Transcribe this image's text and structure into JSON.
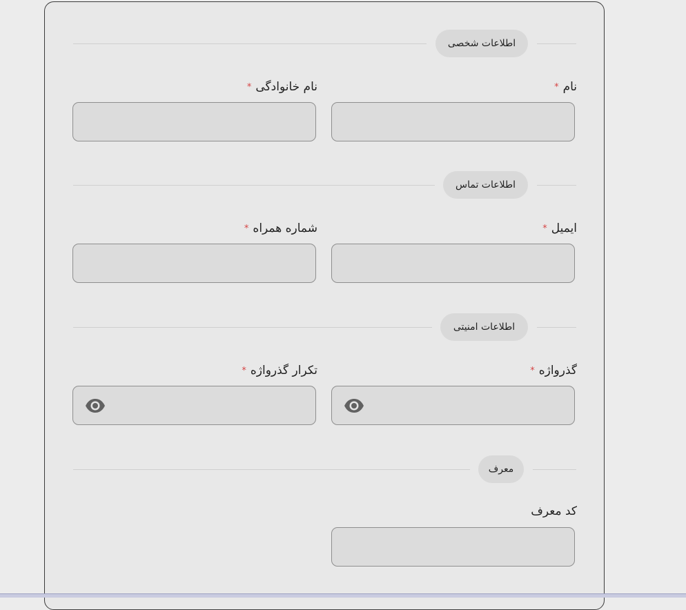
{
  "sections": {
    "personal": {
      "title": "اطلاعات شخصی",
      "first_name_label": "نام",
      "last_name_label": "نام خانوادگی",
      "first_name_value": "",
      "last_name_value": ""
    },
    "contact": {
      "title": "اطلاعات تماس",
      "email_label": "ایمیل",
      "phone_label": "شماره همراه",
      "email_value": "",
      "phone_value": ""
    },
    "security": {
      "title": "اطلاعات امنیتی",
      "password_label": "گذرواژه",
      "confirm_password_label": "تکرار گذرواژه",
      "password_value": "",
      "confirm_password_value": ""
    },
    "referrer": {
      "title": "معرف",
      "code_label": "کد معرف",
      "code_value": ""
    }
  },
  "required_marker": "*",
  "icons": {
    "password_toggle": "eye-icon",
    "confirm_password_toggle": "eye-icon"
  },
  "colors": {
    "required": "#d64545",
    "pill_background": "#d9d9d9",
    "input_background": "#dcdcdc"
  }
}
